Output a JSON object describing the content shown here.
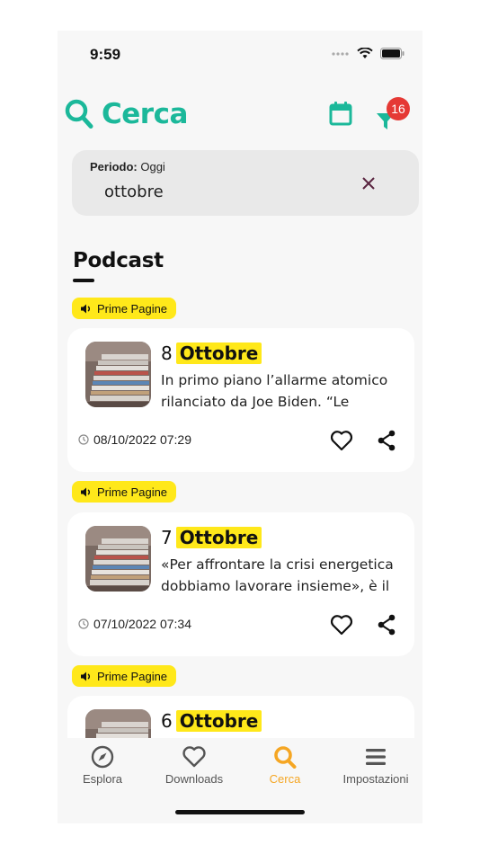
{
  "status_bar": {
    "time": "9:59"
  },
  "header": {
    "title": "Cerca",
    "filter_count": "16"
  },
  "search": {
    "period_label": "Periodo:",
    "period_value": "Oggi",
    "query": "ottobre"
  },
  "section": {
    "title": "Podcast"
  },
  "episodes": [
    {
      "tag": "Prime Pagine",
      "day": "8",
      "month": "Ottobre",
      "description": "In primo piano l’allarme atomico rilanciato da Joe Biden. “Le minacce",
      "date": "08/10/2022 07:29"
    },
    {
      "tag": "Prime Pagine",
      "day": "7",
      "month": "Ottobre",
      "description": "«Per affrontare la crisi energetica dobbiamo lavorare insieme», è il",
      "date": "07/10/2022 07:34"
    },
    {
      "tag": "Prime Pagine",
      "day": "6",
      "month": "Ottobre",
      "description": "",
      "date": ""
    }
  ],
  "tabs": [
    {
      "label": "Esplora",
      "icon": "compass-icon"
    },
    {
      "label": "Downloads",
      "icon": "heart-icon"
    },
    {
      "label": "Cerca",
      "icon": "search-icon",
      "active": true
    },
    {
      "label": "Impostazioni",
      "icon": "menu-icon"
    }
  ],
  "colors": {
    "accent": "#1bb89a",
    "highlight": "#ffe81a",
    "badge": "#e53935",
    "active_tab": "#f5a623"
  }
}
